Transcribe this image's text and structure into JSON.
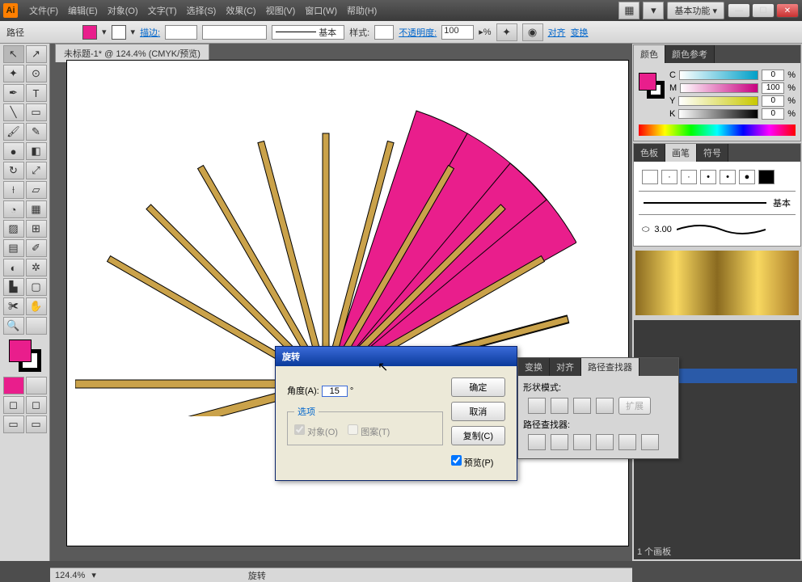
{
  "app": {
    "logo": "Ai"
  },
  "menu": {
    "file": "文件(F)",
    "edit": "编辑(E)",
    "object": "对象(O)",
    "type": "文字(T)",
    "select": "选择(S)",
    "effect": "效果(C)",
    "view": "视图(V)",
    "window": "窗口(W)",
    "help": "帮助(H)"
  },
  "workspace": {
    "label": "基本功能 ▾"
  },
  "ctrl": {
    "path": "路径",
    "stroke": "描边:",
    "basic": "基本",
    "style": "样式:",
    "opacity": "不透明度:",
    "opval": "100",
    "pct": "▸%",
    "align": "对齐",
    "transform": "变换"
  },
  "tab": {
    "label": "未标题-1* @ 124.4% (CMYK/预览)"
  },
  "color": {
    "tab1": "颜色",
    "tab2": "颜色参考",
    "c": "C",
    "m": "M",
    "y": "Y",
    "k": "K",
    "cv": "0",
    "mv": "100",
    "yv": "0",
    "kv": "0",
    "pct": "%"
  },
  "swatches": {
    "tab1": "色板",
    "tab2": "画笔",
    "tab3": "符号",
    "basic": "基本",
    "width": "3.00"
  },
  "pathfinder": {
    "tab1": "变换",
    "tab2": "对齐",
    "tab3": "路径查找器",
    "shape": "形状模式:",
    "expand": "扩展",
    "pf": "路径查找器:"
  },
  "dialog": {
    "title": "旋转",
    "angle": "角度(A):",
    "angleval": "15",
    "deg": "°",
    "ok": "确定",
    "cancel": "取消",
    "copy": "复制(C)",
    "preview": "预览(P)",
    "options": "选项",
    "objects": "对象(O)",
    "patterns": "图案(T)"
  },
  "status": {
    "zoom": "124.4%",
    "rotate": "旋转",
    "artboard": "1 个画板"
  }
}
